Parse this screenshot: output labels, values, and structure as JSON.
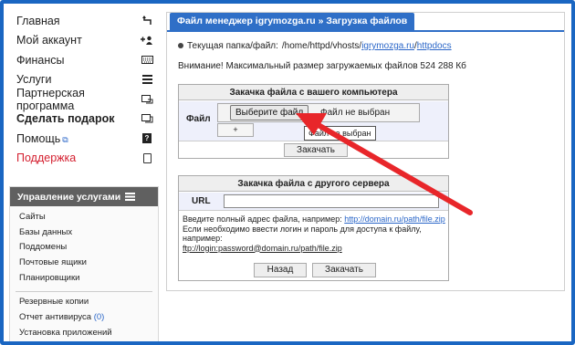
{
  "menu": {
    "items": [
      {
        "label": "Главная",
        "icon": "undo-arrow-icon"
      },
      {
        "label": "Мой аккаунт",
        "icon": "add-user-icon"
      },
      {
        "label": "Финансы",
        "icon": "keyboard-icon"
      },
      {
        "label": "Услуги",
        "icon": "list-icon"
      },
      {
        "label": "Партнерская программа",
        "icon": "share-icon"
      },
      {
        "label": "Сделать подарок",
        "icon": "gift-icon"
      },
      {
        "label": "Помощь",
        "icon": "question-icon"
      },
      {
        "label": "Поддержка",
        "icon": "document-icon"
      }
    ],
    "help_glyph": "?"
  },
  "services": {
    "title": "Управление услугами",
    "items": [
      "Сайты",
      "Базы данных",
      "Поддомены",
      "Почтовые ящики",
      "Планировщики"
    ],
    "extra": [
      {
        "label": "Резервные копии"
      },
      {
        "label": "Отчет антивируса",
        "count": "(0)"
      },
      {
        "label": "Установка приложений"
      }
    ]
  },
  "main": {
    "tab_title": "Файл менеджер igrymozga.ru » Загрузка файлов",
    "folder_label": "Текущая папка/файл:",
    "folder_path_prefix": "/home/httpd/vhosts/",
    "folder_path_domain": "igrymozga.ru",
    "folder_path_sep": "/",
    "folder_path_end": "httpdocs",
    "warning": "Внимание! Максимальный размер загружаемых файлов 524 288 Кб",
    "local_upload": {
      "title": "Закачка файла с вашего компьютера",
      "file_label": "Файл",
      "choose_button": "Выберите файл",
      "no_file": "Файл не выбран",
      "plus_button": "+",
      "tooltip": "Файл не выбран",
      "upload_button": "Закачать"
    },
    "remote_upload": {
      "title": "Закачка файла с другого сервера",
      "url_label": "URL",
      "url_value": "",
      "hint_line1": "Введите полный адрес файла, например: ",
      "hint_example": "http://domain.ru/path/file.zip",
      "hint_line2": "Если необходимо ввести логин и пароль для доступа к файлу, например:",
      "hint_ftp": "ftp://login:password@domain.ru/path/file.zip",
      "back_button": "Назад",
      "upload_button": "Закачать"
    }
  },
  "colors": {
    "frame": "#1a66c2",
    "tab": "#2f6fc7",
    "arrow": "#e8262a",
    "support": "#d42030"
  }
}
